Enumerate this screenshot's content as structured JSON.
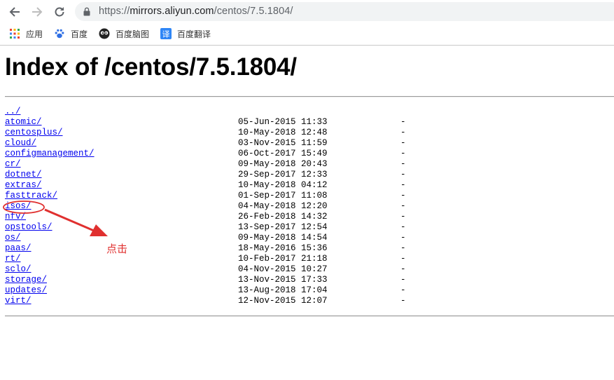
{
  "browser": {
    "url_scheme": "https://",
    "url_host": "mirrors.aliyun.com",
    "url_path": "/centos/7.5.1804/",
    "back_icon": "arrow-left-icon",
    "forward_icon": "arrow-right-icon",
    "reload_icon": "reload-icon",
    "lock_icon": "lock-icon"
  },
  "bookmarks": [
    {
      "label": "应用",
      "icon": "apps-grid-icon"
    },
    {
      "label": "百度",
      "icon": "baidu-paw-icon"
    },
    {
      "label": "百度脑图",
      "icon": "baidu-naotu-icon"
    },
    {
      "label": "百度翻译",
      "icon": "baidu-fanyi-icon"
    }
  ],
  "page": {
    "title": "Index of /centos/7.5.1804/",
    "parent_link": "../",
    "entries": [
      {
        "name": "atomic/",
        "date": "05-Jun-2015 11:33",
        "size": "-"
      },
      {
        "name": "centosplus/",
        "date": "10-May-2018 12:48",
        "size": "-"
      },
      {
        "name": "cloud/",
        "date": "03-Nov-2015 11:59",
        "size": "-"
      },
      {
        "name": "configmanagement/",
        "date": "06-Oct-2017 15:49",
        "size": "-"
      },
      {
        "name": "cr/",
        "date": "09-May-2018 20:43",
        "size": "-"
      },
      {
        "name": "dotnet/",
        "date": "29-Sep-2017 12:33",
        "size": "-"
      },
      {
        "name": "extras/",
        "date": "10-May-2018 04:12",
        "size": "-"
      },
      {
        "name": "fasttrack/",
        "date": "01-Sep-2017 11:08",
        "size": "-"
      },
      {
        "name": "isos/",
        "date": "04-May-2018 12:20",
        "size": "-"
      },
      {
        "name": "nfv/",
        "date": "26-Feb-2018 14:32",
        "size": "-"
      },
      {
        "name": "opstools/",
        "date": "13-Sep-2017 12:54",
        "size": "-"
      },
      {
        "name": "os/",
        "date": "09-May-2018 14:54",
        "size": "-"
      },
      {
        "name": "paas/",
        "date": "18-May-2016 15:36",
        "size": "-"
      },
      {
        "name": "rt/",
        "date": "10-Feb-2017 21:18",
        "size": "-"
      },
      {
        "name": "sclo/",
        "date": "04-Nov-2015 10:27",
        "size": "-"
      },
      {
        "name": "storage/",
        "date": "13-Nov-2015 17:33",
        "size": "-"
      },
      {
        "name": "updates/",
        "date": "13-Aug-2018 17:04",
        "size": "-"
      },
      {
        "name": "virt/",
        "date": "12-Nov-2015 12:07",
        "size": "-"
      }
    ]
  },
  "annotation": {
    "label": "点击",
    "color": "#e0302f",
    "marker_icon": "red-circle-annotation",
    "pointer_icon": "red-arrow-annotation"
  },
  "colors": {
    "link": "#0000ee",
    "omnibox_bg": "#f1f3f4"
  }
}
